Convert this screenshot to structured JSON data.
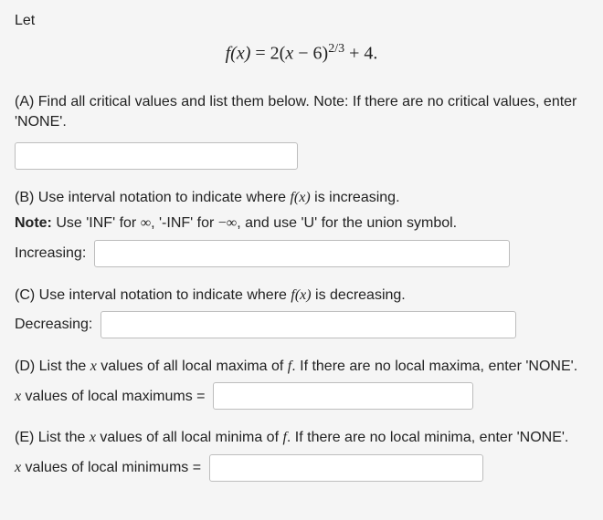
{
  "intro": {
    "let": "Let"
  },
  "formula": {
    "lhs": "f(x)",
    "eq": " = ",
    "rhs_a": "2(",
    "rhs_b": "x",
    "rhs_c": " − 6)",
    "exp": "2/3",
    "rhs_d": " + 4."
  },
  "parts": {
    "A": {
      "text": "(A) Find all critical values and list them below. Note: If there are no critical values, enter 'NONE'."
    },
    "B": {
      "line1_a": "(B) Use interval notation to indicate where ",
      "line1_fx": "f(x)",
      "line1_b": " is increasing.",
      "note_a": "Note:",
      "note_b": " Use 'INF' for ",
      "note_inf": "∞",
      "note_c": ", '-INF' for ",
      "note_neginf": "−∞",
      "note_d": ", and use 'U' for the union symbol.",
      "label": "Increasing:"
    },
    "C": {
      "line_a": "(C) Use interval notation to indicate where ",
      "line_fx": "f(x)",
      "line_b": " is decreasing.",
      "label": "Decreasing:"
    },
    "D": {
      "line_a": "(D) List the ",
      "line_x": "x",
      "line_b": " values of all local maxima of ",
      "line_f": "f",
      "line_c": ". If there are no local maxima, enter 'NONE'.",
      "label_x": "x",
      "label_rest": " values of local maximums ="
    },
    "E": {
      "line_a": "(E) List the ",
      "line_x": "x",
      "line_b": " values of all local minima of ",
      "line_f": "f",
      "line_c": ". If there are no local minima, enter 'NONE'.",
      "label_x": "x",
      "label_rest": " values of local minimums ="
    }
  }
}
